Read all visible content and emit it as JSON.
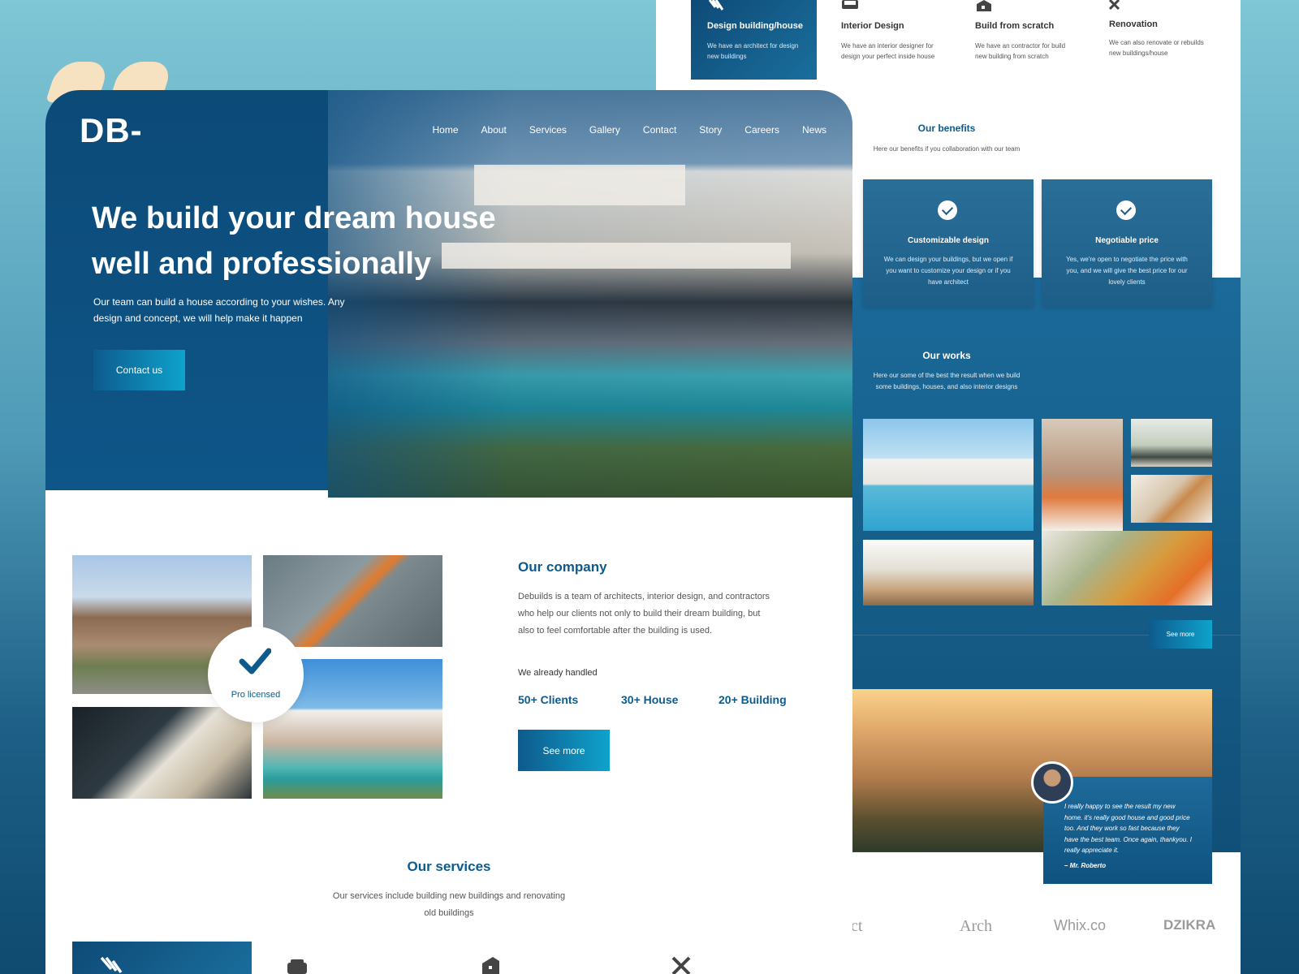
{
  "back_page": {
    "services": [
      {
        "title": "Design building/house",
        "desc": "We have an architect for design new buildings",
        "icon": "pencil-ruler-icon",
        "active": true
      },
      {
        "title": "Interior Design",
        "desc": "We have an interior designer for design your perfect inside house",
        "icon": "sofa-icon",
        "active": false
      },
      {
        "title": "Build from scratch",
        "desc": "We have an contractor for build new building from scratch",
        "icon": "building-icon",
        "active": false
      },
      {
        "title": "Renovation",
        "desc": "We can also renovate or rebuilds new buildings/house",
        "icon": "tools-icon",
        "active": false
      }
    ],
    "benefits": {
      "title": "Our benefits",
      "subtitle": "Here our benefits if you collaboration with our team",
      "items": [
        {
          "title": "Customizable design",
          "desc": "We can design your buildings, but we open if you want to customize your design or if you have architect"
        },
        {
          "title": "Negotiable price",
          "desc": "Yes, we're open to negotiate the price with you, and we will give the best price for our lovely clients"
        }
      ]
    },
    "works": {
      "title": "Our works",
      "subtitle": "Here our some of the best the result when we build some buildings, houses, and also interior designs",
      "see_more": "See more"
    },
    "testimonial": {
      "quote": "I really happy to see the result my new home. it's really good house and good price too. And they work so fast because they have the best team. Once again, thankyou. I really appreciate it.",
      "author": "– Mr. Roberto"
    },
    "partner_logos": [
      "struct",
      "Arch",
      "Whix.co",
      "DZIKRA"
    ]
  },
  "front_page": {
    "brand": "DB-",
    "nav": [
      "Home",
      "About",
      "Services",
      "Gallery",
      "Contact",
      "Story",
      "Careers",
      "News"
    ],
    "hero": {
      "title": "We build your dream house well and professionally",
      "subtitle": "Our team can build a house according to your wishes. Any design and concept, we will help make it happen",
      "cta": "Contact us"
    },
    "badge": "Pro licensed",
    "company": {
      "title": "Our company",
      "text": "Debuilds is a team of architects, interior design, and contractors who help our clients not only to build their dream building, but also to feel comfortable after the building is used.",
      "handled_label": "We already handled",
      "stats": [
        "50+ Clients",
        "30+ House",
        "20+ Building"
      ],
      "cta": "See more"
    },
    "services": {
      "title": "Our services",
      "subtitle": "Our services include building new buildings and renovating old buildings"
    }
  },
  "colors": {
    "primary": "#0d5b8c",
    "dark_blue": "#0c4a78",
    "accent_cyan": "#0ea3cc",
    "bubble": "#fde3bf"
  }
}
